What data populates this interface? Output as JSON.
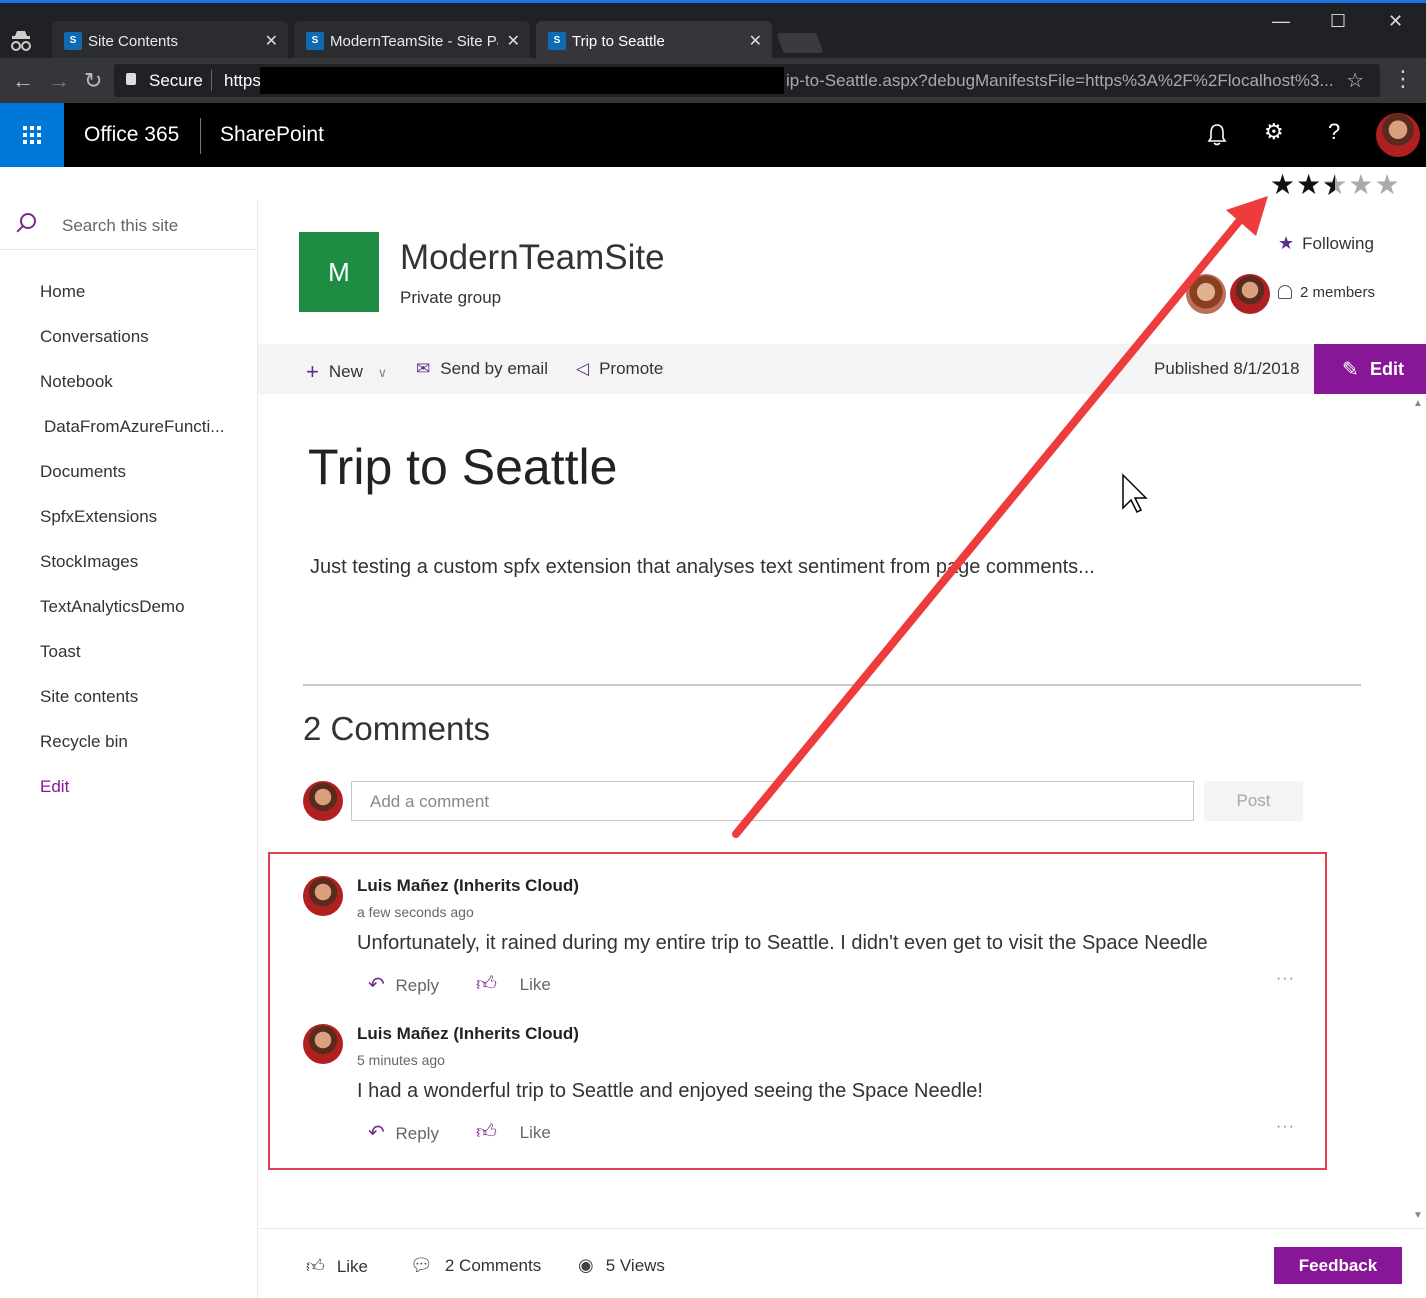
{
  "browser": {
    "tabs": [
      {
        "label": "Site Contents",
        "favicon": "S"
      },
      {
        "label": "ModernTeamSite - Site Pa",
        "favicon": "S"
      },
      {
        "label": "Trip to Seattle",
        "favicon": "S"
      }
    ],
    "secure_label": "Secure",
    "url_prefix": "https",
    "url_rest": "ip-to-Seattle.aspx?debugManifestsFile=https%3A%2F%2Flocalhost%3..."
  },
  "suite": {
    "app_name": "Office 365",
    "product": "SharePoint"
  },
  "rating": {
    "value": 2.5,
    "max": 5
  },
  "leftnav": {
    "search_placeholder": "Search this site",
    "items": [
      "Home",
      "Conversations",
      "Notebook",
      "DataFromAzureFuncti...",
      "Documents",
      "SpfxExtensions",
      "StockImages",
      "TextAnalyticsDemo",
      "Toast",
      "Site contents",
      "Recycle bin"
    ],
    "edit_label": "Edit"
  },
  "site": {
    "logo_letter": "M",
    "name": "ModernTeamSite",
    "subtitle": "Private group",
    "following_label": "Following",
    "members_label": "2 members",
    "brand_color": "#881798"
  },
  "commands": {
    "new_label": "New",
    "email_label": "Send by email",
    "promote_label": "Promote",
    "published": "Published 8/1/2018",
    "edit_label": "Edit"
  },
  "page": {
    "title": "Trip to Seattle",
    "body": "Just testing a custom spfx extension that analyses text sentiment from page comments..."
  },
  "comments": {
    "count_label": "2 Comments",
    "input_placeholder": "Add a comment",
    "post_label": "Post",
    "items": [
      {
        "author": "Luis Mañez (Inherits Cloud)",
        "time": "a few seconds ago",
        "text": "Unfortunately, it rained during my entire trip to Seattle. I didn't even get to visit the Space Needle",
        "reply": "Reply",
        "like": "Like"
      },
      {
        "author": "Luis Mañez (Inherits Cloud)",
        "time": "5 minutes ago",
        "text": "I had a wonderful trip to Seattle and enjoyed seeing the Space Needle!",
        "reply": "Reply",
        "like": "Like"
      }
    ]
  },
  "footer": {
    "like_label": "Like",
    "comments_label": "2 Comments",
    "views_label": "5 Views",
    "feedback_label": "Feedback"
  }
}
